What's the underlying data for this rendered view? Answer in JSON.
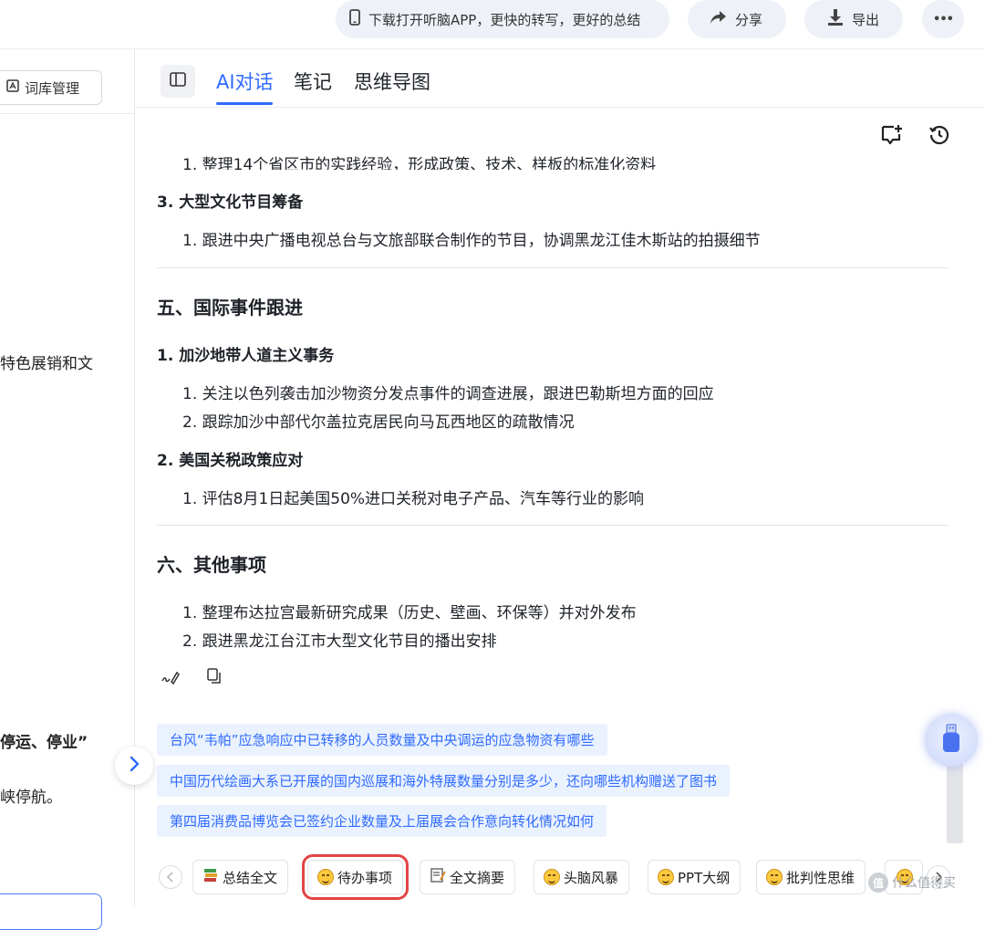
{
  "topbar": {
    "app_promo": "下载打开听脑APP，更快的转写，更好的总结",
    "share_label": "分享",
    "export_label": "导出",
    "more_label": "•••"
  },
  "sidebar": {
    "lexicon_button": "词库管理",
    "fragments": [
      "特色展销和文",
      "停运、停业”",
      "峡停航。"
    ]
  },
  "tabs": [
    "AI对话",
    "笔记",
    "思维导图"
  ],
  "content": {
    "clipped_top_line": "1. 整理14个省区市的实践经验，形成政策、技术、样板的标准化资料",
    "section_3_title": "3. 大型文化节目筹备",
    "section_3_items": [
      "1. 跟进中央广播电视总台与文旅部联合制作的节目，协调黑龙江佳木斯站的拍摄细节"
    ],
    "h5": "五、国际事件跟进",
    "h5_sub1_title": "1. 加沙地带人道主义事务",
    "h5_sub1_items": [
      "1. 关注以色列袭击加沙物资分发点事件的调查进展，跟进巴勒斯坦方面的回应",
      "2. 跟踪加沙中部代尔盖拉克居民向马瓦西地区的疏散情况"
    ],
    "h5_sub2_title": "2. 美国关税政策应对",
    "h5_sub2_items": [
      "1. 评估8月1日起美国50%进口关税对电子产品、汽车等行业的影响"
    ],
    "h6": "六、其他事项",
    "h6_items": [
      "1. 整理布达拉宫最新研究成果（历史、壁画、环保等）并对外发布",
      "2. 跟进黑龙江台江市大型文化节目的播出安排"
    ]
  },
  "suggestions": [
    "台风“韦帕”应急响应中已转移的人员数量及中央调运的应急物资有哪些",
    "中国历代绘画大系已开展的国内巡展和海外特展数量分别是多少，还向哪些机构赠送了图书",
    "第四届消费品博览会已签约企业数量及上届展会合作意向转化情况如何"
  ],
  "chips": [
    {
      "label": "总结全文",
      "icon": "books-icon"
    },
    {
      "label": "待办事项",
      "icon": "grin-emoji-icon"
    },
    {
      "label": "全文摘要",
      "icon": "memo-icon"
    },
    {
      "label": "头脑风暴",
      "icon": "grin-emoji-icon"
    },
    {
      "label": "PPT大纲",
      "icon": "grin-emoji-icon"
    },
    {
      "label": "批判性思维",
      "icon": "grin-emoji-icon"
    }
  ],
  "highlighted_chip": "待办事项",
  "watermark": {
    "glyph": "值",
    "text": "什么值得买"
  },
  "colors": {
    "accent": "#2f6bff",
    "suggestion_bg": "#eaf2fe",
    "highlight_box": "#e24444"
  }
}
